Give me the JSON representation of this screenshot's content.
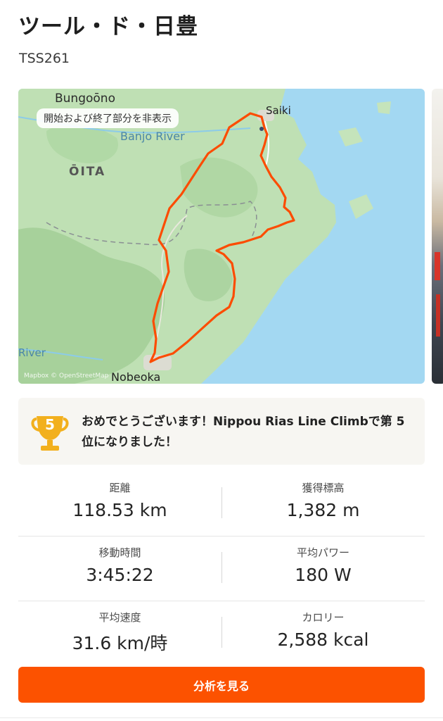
{
  "activity": {
    "title": "ツール・ド・日豊",
    "subtitle": "TSS261"
  },
  "map": {
    "badge": "開始および終了部分を非表示",
    "labels": {
      "bungoono": "Bungoōno",
      "banjo_river": "Banjo River",
      "oita": "ŌITA",
      "saiki": "Saiki",
      "river": "River",
      "nobeoka": "Nobeoka",
      "attribution": "Mapbox © OpenStreetMap"
    },
    "route_color": "#fc4c02",
    "sea_color": "#a3d8f2",
    "land_color": "#bfe0b4"
  },
  "achievement": {
    "rank": "5",
    "text": "おめでとうございます！Nippou Rias Line Climbで第 5 位になりました！",
    "icon": "trophy-icon"
  },
  "stats": {
    "distance": {
      "label": "距離",
      "value": "118.53 km"
    },
    "elevation": {
      "label": "獲得標高",
      "value": "1,382 m"
    },
    "moving_time": {
      "label": "移動時間",
      "value": "3:45:22"
    },
    "avg_power": {
      "label": "平均パワー",
      "value": "180 W"
    },
    "avg_speed": {
      "label": "平均速度",
      "value": "31.6 km/時"
    },
    "calories": {
      "label": "カロリー",
      "value": "2,588 kcal"
    }
  },
  "cta": {
    "label": "分析を見る"
  },
  "colors": {
    "accent": "#fc5200",
    "trophy": "#f2b01e"
  }
}
